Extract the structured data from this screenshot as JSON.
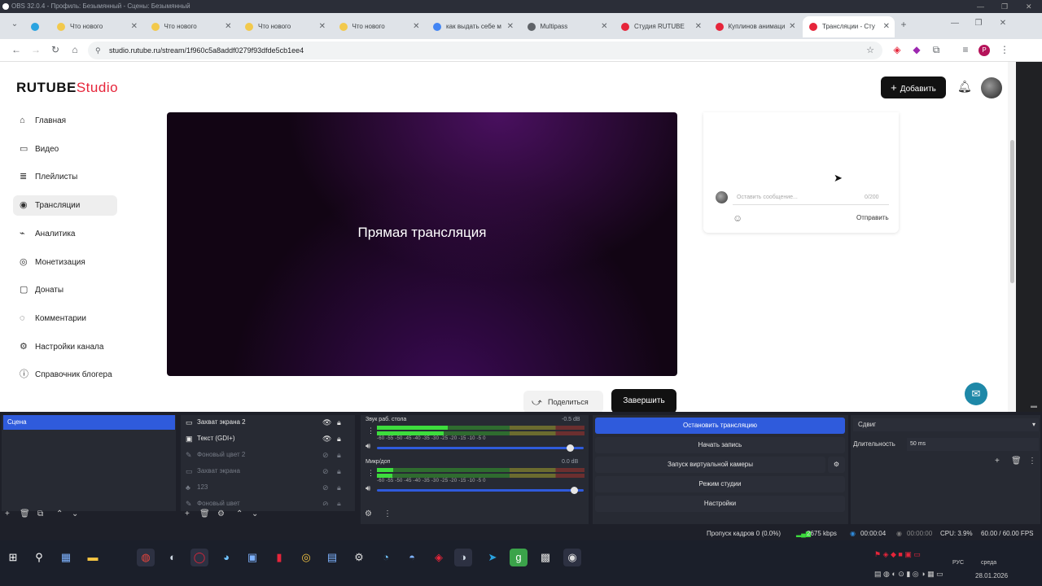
{
  "obs_window": {
    "title": "OBS 32.0.4 - Профиль: Безымянный - Сцены: Безымянный"
  },
  "browser": {
    "tabs": [
      {
        "label": "Что нового",
        "color": "#f2c94c"
      },
      {
        "label": "Что нового",
        "color": "#f2c94c"
      },
      {
        "label": "Что нового",
        "color": "#f2c94c"
      },
      {
        "label": "Что нового",
        "color": "#f2c94c"
      },
      {
        "label": "как выдать себе м",
        "color": "#4285f4"
      },
      {
        "label": "Multipass",
        "color": "#5f6368"
      },
      {
        "label": "Студия RUTUBE",
        "color": "#e6253a"
      },
      {
        "label": "Куплинов анимаци",
        "color": "#e6253a"
      },
      {
        "label": "Трансляции - Сту",
        "color": "#e6253a"
      }
    ],
    "url": "studio.rutube.ru/stream/1f960c5a8addf0279f93dfde5cb1ee4"
  },
  "page": {
    "logo_brand": "RUTUBE",
    "logo_studio": "Studio",
    "add_button": "Добавить",
    "nav": [
      {
        "label": "Главная",
        "icon": "home-icon",
        "glyph": "⌂"
      },
      {
        "label": "Видео",
        "icon": "video-icon",
        "glyph": "▭"
      },
      {
        "label": "Плейлисты",
        "icon": "playlist-icon",
        "glyph": "≣"
      },
      {
        "label": "Трансляции",
        "icon": "broadcast-icon",
        "glyph": "◉"
      },
      {
        "label": "Аналитика",
        "icon": "analytics-icon",
        "glyph": "⌁"
      },
      {
        "label": "Монетизация",
        "icon": "money-icon",
        "glyph": "◎"
      },
      {
        "label": "Донаты",
        "icon": "donate-icon",
        "glyph": "▢"
      },
      {
        "label": "Комментарии",
        "icon": "comment-icon",
        "glyph": "◌"
      },
      {
        "label": "Настройки канала",
        "icon": "settings-icon",
        "glyph": "⚙"
      },
      {
        "label": "Справочник блогера",
        "icon": "info-icon",
        "glyph": "ⓘ"
      }
    ],
    "active_nav": 3,
    "player_label": "Прямая трансляция",
    "share_button": "Поделиться",
    "end_button": "Завершить",
    "chat": {
      "placeholder": "Оставить сообщение...",
      "counter": "0/200",
      "send": "Отправить"
    }
  },
  "obs": {
    "scenes": [
      "Сцена"
    ],
    "sources": [
      {
        "label": "Захват экрана 2",
        "visible": true
      },
      {
        "label": "Текст (GDI+)",
        "visible": true
      },
      {
        "label": "Фоновый цвет 2",
        "visible": false
      },
      {
        "label": "Захват экрана",
        "visible": false
      },
      {
        "label": "123",
        "visible": false
      },
      {
        "label": "Фоновый цвет",
        "visible": false
      }
    ],
    "mixer": [
      {
        "name": "Звук раб. стола",
        "db": "-0.5 dB",
        "level": 0.34,
        "volume": 0.95
      },
      {
        "name": "Микр/доп",
        "db": "0.0 dB",
        "level": 0.08,
        "volume": 0.97
      }
    ],
    "meter_ticks": "-60 -55 -50 -45 -40 -35 -30 -25 -20 -15 -10 -5 0",
    "controls": {
      "stop_stream": "Остановить трансляцию",
      "start_record": "Начать запись",
      "virtual_cam": "Запуск виртуальной камеры",
      "studio_mode": "Режим студии",
      "settings": "Настройки"
    },
    "transition": {
      "type": "Сдвиг",
      "duration_label": "Длительность",
      "duration": "50 ms"
    },
    "status": {
      "dropped": "Пропуск кадров 0 (0.0%)",
      "bitrate": "2675 kbps",
      "stream_time": "00:00:04",
      "rec_time": "00:00:00",
      "cpu": "CPU: 3.9%",
      "fps": "60.00 / 60.00 FPS"
    }
  },
  "taskbar": {
    "lang": "РУС",
    "day": "среда",
    "date": "28.01.2026"
  }
}
